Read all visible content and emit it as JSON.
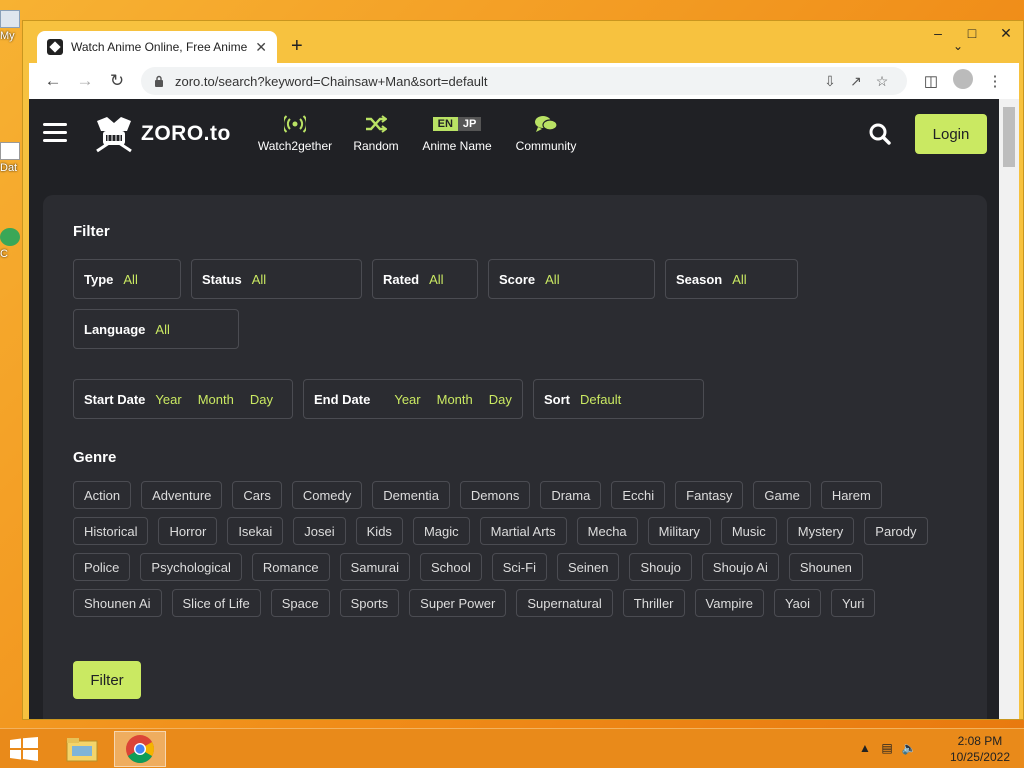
{
  "desktop": {
    "icon_labels": [
      "My",
      "Dat",
      "C"
    ]
  },
  "browser": {
    "tab_title": "Watch Anime Online, Free Anime",
    "url": "zoro.to/search?keyword=Chainsaw+Man&sort=default"
  },
  "site": {
    "logo_text": "ZORO.to",
    "nav": [
      {
        "label": "Watch2gether",
        "icon": "broadcast-icon"
      },
      {
        "label": "Random",
        "icon": "shuffle-icon"
      },
      {
        "label": "Anime Name",
        "icon": "language-toggle"
      },
      {
        "label": "Community",
        "icon": "chat-icon"
      }
    ],
    "lang": {
      "en": "EN",
      "jp": "JP"
    },
    "login_label": "Login",
    "accent_color": "#cae962"
  },
  "filter": {
    "title": "Filter",
    "type": {
      "key": "Type",
      "value": "All"
    },
    "status": {
      "key": "Status",
      "value": "All"
    },
    "rated": {
      "key": "Rated",
      "value": "All"
    },
    "score": {
      "key": "Score",
      "value": "All"
    },
    "season": {
      "key": "Season",
      "value": "All"
    },
    "language": {
      "key": "Language",
      "value": "All"
    },
    "start_date": {
      "key": "Start Date",
      "year": "Year",
      "month": "Month",
      "day": "Day"
    },
    "end_date": {
      "key": "End Date",
      "year": "Year",
      "month": "Month",
      "day": "Day"
    },
    "sort": {
      "key": "Sort",
      "value": "Default"
    },
    "genre_title": "Genre",
    "genres": [
      "Action",
      "Adventure",
      "Cars",
      "Comedy",
      "Dementia",
      "Demons",
      "Drama",
      "Ecchi",
      "Fantasy",
      "Game",
      "Harem",
      "Historical",
      "Horror",
      "Isekai",
      "Josei",
      "Kids",
      "Magic",
      "Martial Arts",
      "Mecha",
      "Military",
      "Music",
      "Mystery",
      "Parody",
      "Police",
      "Psychological",
      "Romance",
      "Samurai",
      "School",
      "Sci-Fi",
      "Seinen",
      "Shoujo",
      "Shoujo Ai",
      "Shounen",
      "Shounen Ai",
      "Slice of Life",
      "Space",
      "Sports",
      "Super Power",
      "Supernatural",
      "Thriller",
      "Vampire",
      "Yaoi",
      "Yuri"
    ],
    "submit_label": "Filter"
  },
  "taskbar": {
    "time": "2:08 PM",
    "date": "10/25/2022"
  }
}
